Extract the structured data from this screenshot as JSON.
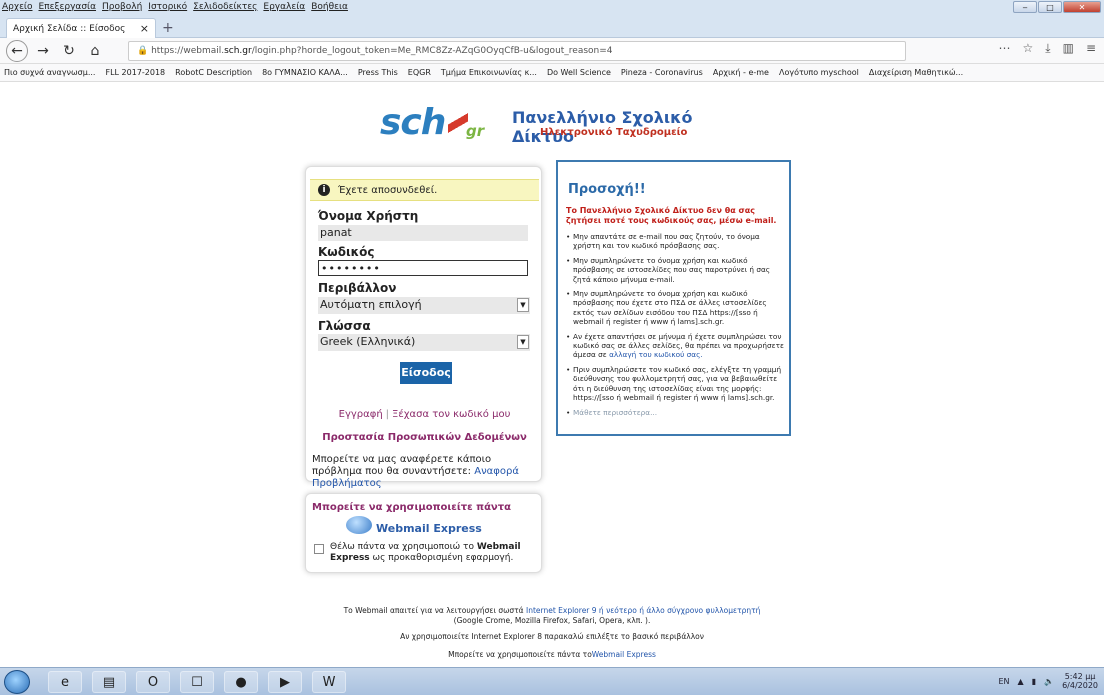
{
  "menubar": {
    "items": [
      "Αρχείο",
      "Επεξεργασία",
      "Προβολή",
      "Ιστορικό",
      "Σελιδοδείκτες",
      "Εργαλεία",
      "Βοήθεια"
    ]
  },
  "tab": {
    "title": "Αρχική Σελίδα :: Είσοδος",
    "close": "×",
    "new_tab": "+"
  },
  "url": {
    "prefix": "https://webmail.",
    "host": "sch.gr",
    "path": "/login.php?horde_logout_token=Me_RMC8Zz-AZqG0OyqCfB-u&logout_reason=4"
  },
  "bookmarks": [
    "Πιο συχνά αναγνωσμ...",
    "FLL 2017-2018",
    "RobotC Description",
    "8ο ΓΥΜΝΑΣΙΟ ΚΑΛΑ...",
    "Press This",
    "EQGR",
    "Τμήμα Επικοινωνίας κ...",
    "Do Well Science",
    "Pineza - Coronavirus",
    "Αρχική - e-me",
    "Λογότυπο myschool",
    "Διαχείριση Μαθητικώ..."
  ],
  "logo": {
    "sch": "sch",
    "gr": "gr",
    "title": "Πανελλήνιο Σχολικό Δίκτυο",
    "subtitle": "Ηλεκτρονικό Ταχυδρομείο"
  },
  "login": {
    "notice": "Έχετε αποσυνδεθεί.",
    "username_label": "Όνομα Χρήστη",
    "username_value": "panat",
    "password_label": "Κωδικός",
    "password_value": "••••••••",
    "env_label": "Περιβάλλον",
    "env_value": "Αυτόματη επιλογή",
    "lang_label": "Γλώσσα",
    "lang_value": "Greek (Ελληνικά)",
    "login_button": "Είσοδος",
    "register_link": "Εγγραφή",
    "forgot_link": "Ξέχασα τον κωδικό μου",
    "privacy_link": "Προστασία Προσωπικών Δεδομένων",
    "report_text": "Μπορείτε να μας αναφέρετε κάποιο πρόβλημα που θα συναντήσετε:",
    "report_link": "Αναφορά Προβλήματος"
  },
  "express": {
    "title": "Μπορείτε να χρησιμοποιείτε πάντα",
    "name": "Webmail Express",
    "checkbox_text_pre": "Θέλω πάντα να χρησιμοποιώ το",
    "checkbox_text_bold": "Webmail Express",
    "checkbox_text_post": "ως προκαθορισμένη εφαρμογή."
  },
  "warning": {
    "title": "Προσοχή!!",
    "red": "Το Πανελλήνιο Σχολικό Δίκτυο δεν θα σας ζητήσει ποτέ τους κωδικούς σας, μέσω e-mail.",
    "b1": "Μην απαντάτε σε e-mail που σας ζητούν, το όνομα χρήστη και τον κωδικό πρόσβασης σας.",
    "b2": "Μην συμπληρώνετε το όνομα χρήση και κωδικό πρόσβασης σε ιστοσελίδες που σας παροτρύνει ή σας ζητά κάποιο μήνυμα e-mail.",
    "b3": "Μην συμπληρώνετε το όνομα χρήση και κωδικό πρόσβασης που έχετε στο ΠΣΔ σε άλλες ιστοσελίδες εκτός των σελίδων εισόδου του ΠΣΔ https://[sso ή webmail ή register ή www ή lams].sch.gr.",
    "b4_pre": "Αν έχετε απαντήσει σε μήνυμα ή έχετε συμπληρώσει τον κωδικό σας σε άλλες σελίδες, θα πρέπει να προχωρήσετε άμεσα σε",
    "b4_link": "αλλαγή του κωδικού σας.",
    "b5": "Πριν συμπληρώσετε τον κωδικό σας, ελέγξτε τη γραμμή διεύθυνσης του φυλλομετρητή σας, για να βεβαιωθείτε ότι η διεύθυνση της ιστοσελίδας είναι της μορφής: https://[sso ή webmail ή register ή www ή lams].sch.gr.",
    "more": "Μάθετε περισσότερα..."
  },
  "footer": {
    "l1_pre": "Το Webmail απαιτεί για να λειτουργήσει σωστά",
    "l1_link": "Internet Explorer 9 ή νεότερο ή άλλο σύγχρονο φυλλομετρητή",
    "l2": "(Google Crome, Mozilla Firefox, Safari, Opera, κλπ. ).",
    "l3": "Αν χρησιμοποιείτε Internet Explorer 8 παρακαλώ επιλέξτε το βασικό περιβάλλον",
    "l4_pre": "Μπορείτε να χρησιμοποιείτε πάντα το",
    "l4_link": "Webmail Express"
  },
  "taskbar": {
    "lang": "EN",
    "time": "5:42 μμ",
    "date": "6/4/2020"
  }
}
